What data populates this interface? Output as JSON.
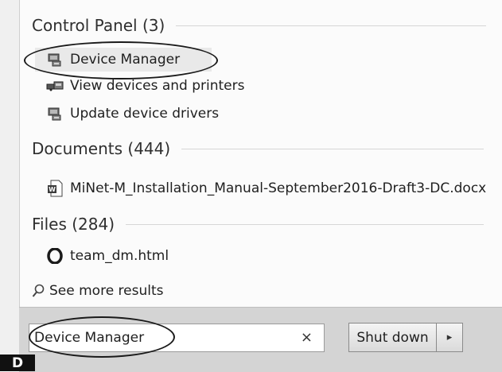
{
  "groups": {
    "control_panel": {
      "header": "Control Panel (3)",
      "items": [
        {
          "label": "Device Manager",
          "icon": "device-manager-icon"
        },
        {
          "label": "View devices and printers",
          "icon": "devices-printers-icon"
        },
        {
          "label": "Update device drivers",
          "icon": "device-manager-icon"
        }
      ]
    },
    "documents": {
      "header": "Documents (444)",
      "items": [
        {
          "label": "MiNet-M_Installation_Manual-September2016-Draft3-DC.docx",
          "icon": "word-document-icon"
        }
      ]
    },
    "files": {
      "header": "Files (284)",
      "items": [
        {
          "label": "team_dm.html",
          "icon": "opera-html-icon"
        }
      ]
    }
  },
  "see_more": "See more results",
  "search": {
    "value": "Device Manager",
    "clear_glyph": "×"
  },
  "shutdown": {
    "label": "Shut down",
    "arrow": "▸"
  },
  "corner_tag": "D",
  "colors": {
    "oval_stroke": "#1a1a1a",
    "highlight": "#e9e9e9",
    "bottom_bar": "#d4d4d4"
  }
}
